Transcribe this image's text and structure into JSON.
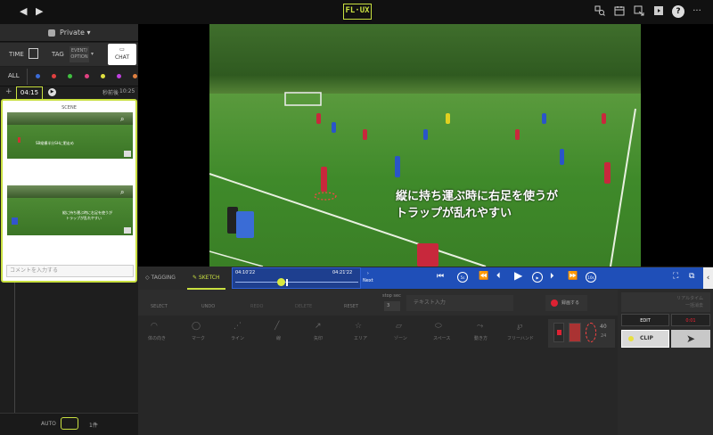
{
  "topbar": {
    "logo": "FL·UX",
    "nav_back": "◀",
    "nav_forward": "▶",
    "icons": [
      "tag-search-icon",
      "calendar-icon",
      "export-icon",
      "video-icon",
      "help-icon",
      "more-icon"
    ],
    "help": "?",
    "more": "···"
  },
  "left": {
    "privacy": "Private",
    "modes": {
      "time": "TIME",
      "tag": "TAG",
      "event": "EVENT/",
      "option": "OPTION",
      "chat": "CHAT"
    },
    "filter_all": "ALL",
    "colors": [
      "#3b6bd6",
      "#e04040",
      "#40c040",
      "#e04080",
      "#e0e040",
      "#c040e0",
      "#e08040"
    ],
    "time_value": "04:15",
    "time_right_label": "秒前後",
    "time_right_value": "10:25",
    "scene_label": "SCENE",
    "scene1_caption": "SB縦横半分SHに肥走め",
    "scene2_caption_1": "縦に持ち運ぶ時に右足を使うが",
    "scene2_caption_2": "トラップが乱れやすい",
    "comment_placeholder": "コメントを入力する",
    "footer_auto": "AUTO",
    "footer_count": "1件"
  },
  "video": {
    "overlay_line1": "縦に持ち運ぶ時に右足を使うが",
    "overlay_line2": "トラップが乱れやすい"
  },
  "timeline": {
    "tab_tagging": "TAGGING",
    "tab_sketch": "SKETCH",
    "start_time": "04:10'22",
    "end_time": "04:21'22",
    "next_label": "Next",
    "skip_back": "5s",
    "skip_fwd": "5s",
    "skip_fwd_big": "10s"
  },
  "tools": {
    "row1": [
      "SELECT",
      "UNDO",
      "REDO",
      "DELETE",
      "RESET"
    ],
    "stop_label": "stop sec",
    "stop_value": "3",
    "text_input_placeholder": "テキスト入力",
    "record_label": "録画する",
    "row2": [
      "体の向き",
      "マーク",
      "ライン",
      "線",
      "矢印",
      "エリア",
      "ゾーン",
      "スペース",
      "動き方",
      "フリーハンド"
    ],
    "size_value": "40",
    "size_sub": "24"
  },
  "right": {
    "realtime_1": "リアルタイム",
    "realtime_2": "一括消去",
    "edit": "EDIT",
    "rec_badge": "0:01",
    "clip": "CLIP"
  }
}
